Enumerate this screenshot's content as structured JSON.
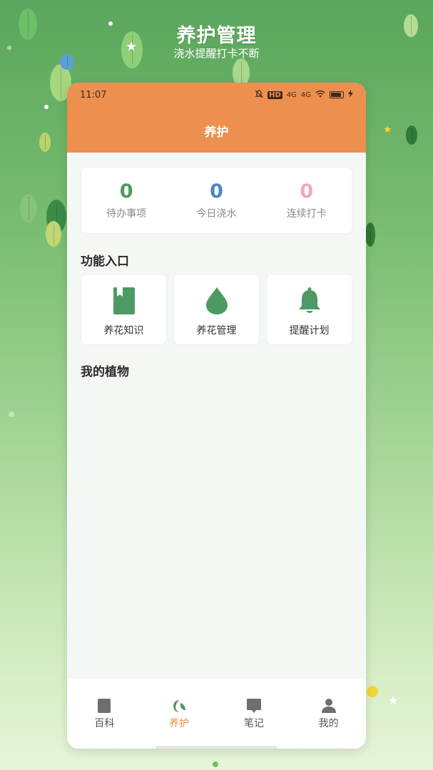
{
  "banner": {
    "title": "养护管理",
    "subtitle": "浇水提醒打卡不断"
  },
  "status_bar": {
    "time": "11:07",
    "icons": [
      "mute-icon",
      "hd-icon",
      "signal-4g-icon",
      "signal-4g-icon",
      "wifi-icon",
      "battery-icon",
      "charging-icon"
    ],
    "network_label_1": "4G",
    "network_label_2": "4G",
    "hd_label": "HD"
  },
  "header": {
    "title": "养护",
    "color": "#ed8f4e"
  },
  "stats": [
    {
      "value": "0",
      "label": "待办事项",
      "color": "#4d9a62"
    },
    {
      "value": "0",
      "label": "今日浇水",
      "color": "#4a86c8"
    },
    {
      "value": "0",
      "label": "连续打卡",
      "color": "#f0a7c0"
    }
  ],
  "features_section": {
    "title": "功能入口",
    "items": [
      {
        "label": "养花知识",
        "icon": "book-icon"
      },
      {
        "label": "养花管理",
        "icon": "water-drop-icon"
      },
      {
        "label": "提醒计划",
        "icon": "bell-icon"
      }
    ]
  },
  "plants_section": {
    "title": "我的植物"
  },
  "tabbar": {
    "active": "养护",
    "items": [
      {
        "label": "百科",
        "icon": "book-icon"
      },
      {
        "label": "养护",
        "icon": "leaf-moon-icon"
      },
      {
        "label": "笔记",
        "icon": "note-icon"
      },
      {
        "label": "我的",
        "icon": "user-icon"
      }
    ]
  },
  "colors": {
    "accent": "#ed8f4e",
    "green": "#4d9a62",
    "background": "#f4f8f4"
  }
}
